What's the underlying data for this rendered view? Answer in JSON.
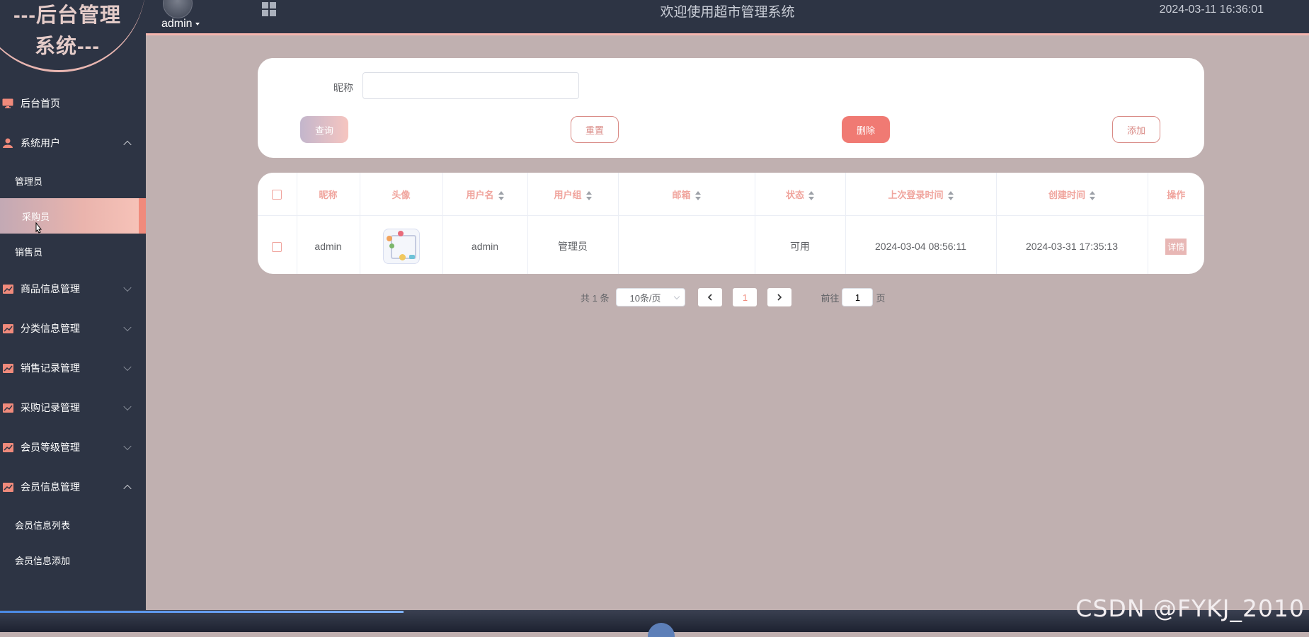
{
  "sidebar": {
    "logo_line1": "---后台管理",
    "logo_line2": "系统---",
    "menu": [
      {
        "label": "后台首页",
        "icon": "monitor-icon"
      },
      {
        "label": "系统用户",
        "icon": "user-icon",
        "expanded": true
      },
      {
        "label": "管理员",
        "sub": true
      },
      {
        "label": "采购员",
        "sub": true,
        "active": true
      },
      {
        "label": "销售员",
        "sub": true
      },
      {
        "label": "商品信息管理",
        "icon": "chart-icon"
      },
      {
        "label": "分类信息管理",
        "icon": "chart-icon"
      },
      {
        "label": "销售记录管理",
        "icon": "chart-icon"
      },
      {
        "label": "采购记录管理",
        "icon": "chart-icon"
      },
      {
        "label": "会员等级管理",
        "icon": "chart-icon"
      },
      {
        "label": "会员信息管理",
        "icon": "chart-icon",
        "expanded": true
      },
      {
        "label": "会员信息列表",
        "sub": true
      },
      {
        "label": "会员信息添加",
        "sub": true
      }
    ]
  },
  "topbar": {
    "username": "admin",
    "welcome": "欢迎使用超市管理系统",
    "datetime": "2024-03-11 16:36:01"
  },
  "search": {
    "nickname_label": "昵称",
    "nickname_value": "",
    "query_label": "查询",
    "reset_label": "重置",
    "delete_label": "删除",
    "add_label": "添加"
  },
  "table": {
    "headers": [
      "昵称",
      "头像",
      "用户名",
      "用户组",
      "邮箱",
      "状态",
      "上次登录时间",
      "创建时间",
      "操作"
    ],
    "rows": [
      {
        "nickname": "admin",
        "username": "admin",
        "group": "管理员",
        "email": "",
        "status": "可用",
        "last_login": "2024-03-04 08:56:11",
        "created": "2024-03-31 17:35:13",
        "action": "详情"
      }
    ]
  },
  "pagination": {
    "total": "共 1 条",
    "page_size": "10条/页",
    "current_page": "1",
    "goto_label": "前往",
    "goto_value": "1",
    "page_suffix": "页"
  },
  "watermark": "CSDN @FYKJ_2010",
  "colors": {
    "sidebar_bg": "#2d3444",
    "content_bg": "#c0b0b0",
    "accent": "#f08a7b",
    "header_text": "#f0a59e"
  }
}
